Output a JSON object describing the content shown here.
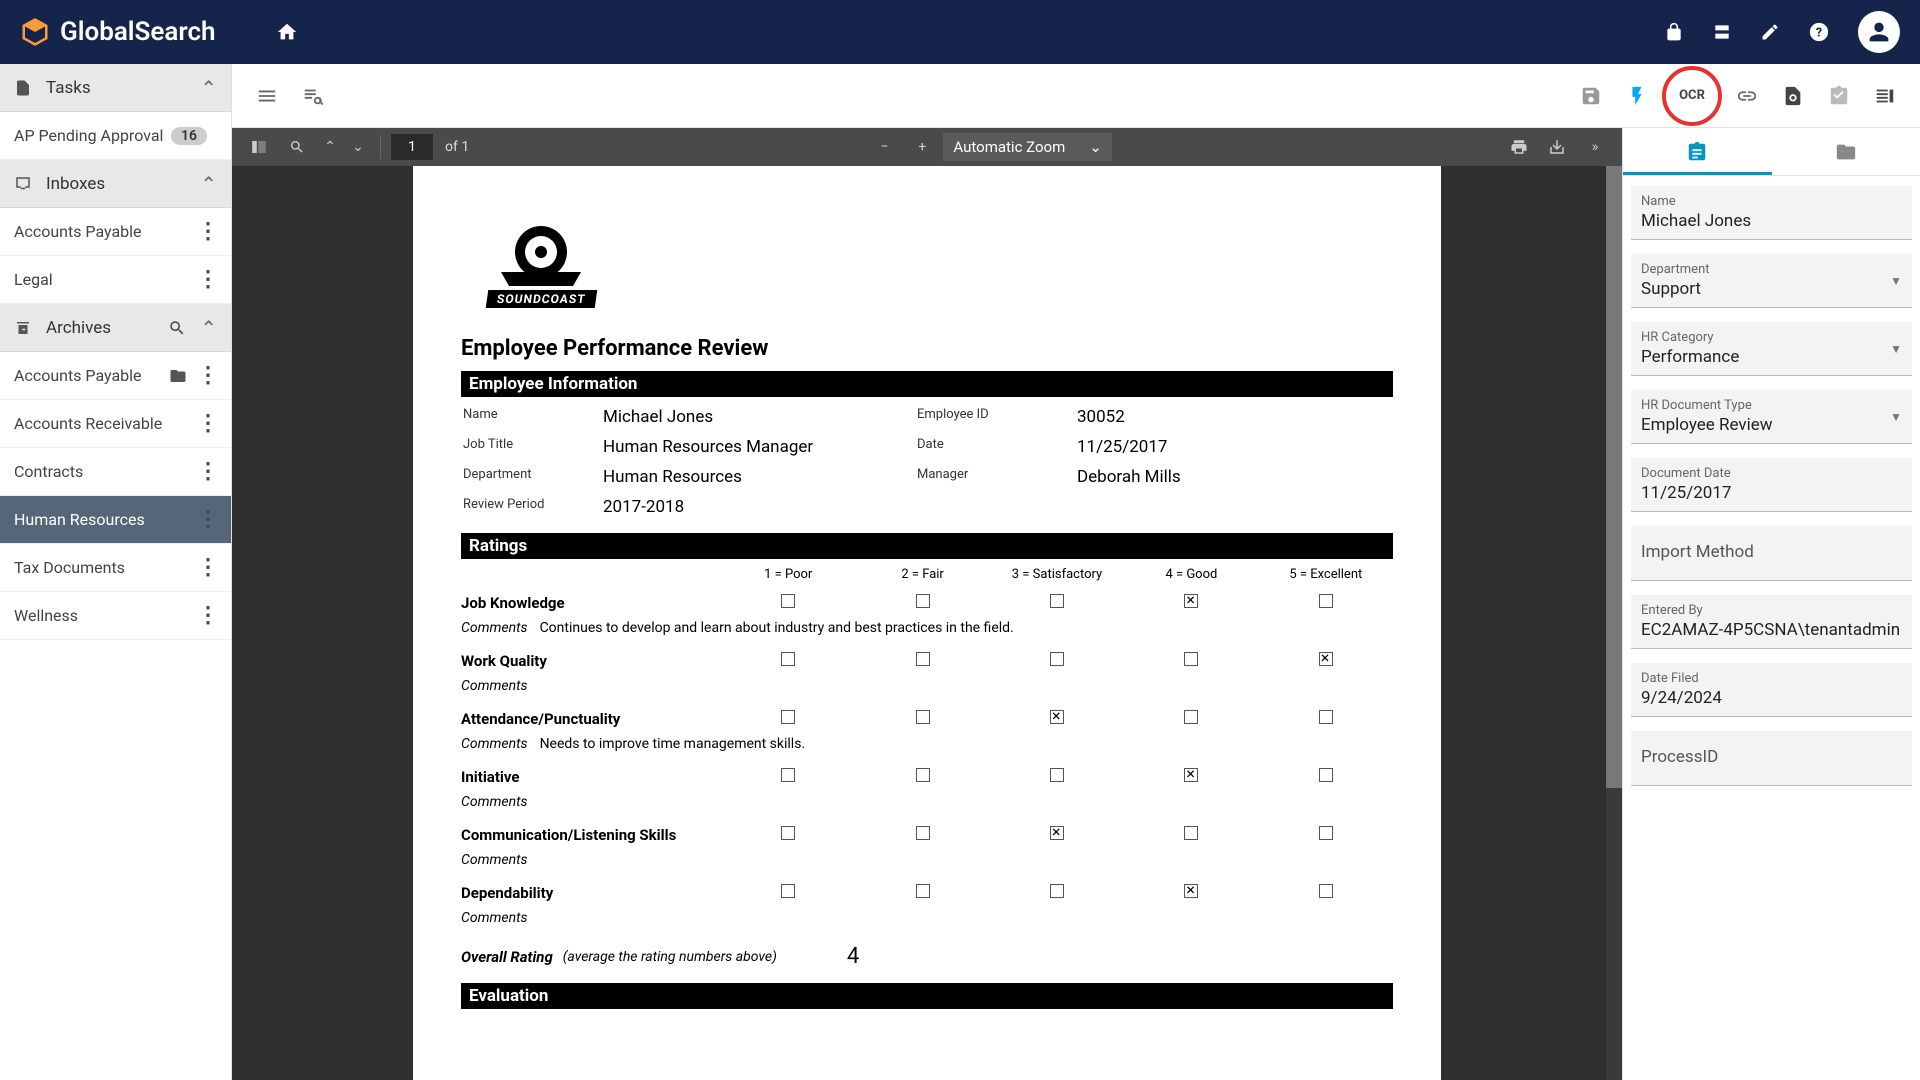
{
  "header": {
    "app_name": "GlobalSearch"
  },
  "sidebar": {
    "tasks": {
      "label": "Tasks"
    },
    "tasks_items": [
      {
        "label": "AP Pending Approval",
        "badge": "16"
      }
    ],
    "inboxes": {
      "label": "Inboxes"
    },
    "inboxes_items": [
      {
        "label": "Accounts Payable"
      },
      {
        "label": "Legal"
      }
    ],
    "archives": {
      "label": "Archives"
    },
    "archives_items": [
      {
        "label": "Accounts Payable",
        "folder": true
      },
      {
        "label": "Accounts Receivable"
      },
      {
        "label": "Contracts"
      },
      {
        "label": "Human Resources",
        "selected": true
      },
      {
        "label": "Tax Documents"
      },
      {
        "label": "Wellness"
      }
    ]
  },
  "toolbar": {
    "ocr_label": "OCR"
  },
  "pdf": {
    "current_page": "1",
    "page_of": "of 1",
    "zoom": "Automatic Zoom"
  },
  "document": {
    "logo_text": "SOUNDCOAST",
    "title": "Employee Performance Review",
    "section_info": "Employee Information",
    "section_ratings": "Ratings",
    "section_evaluation": "Evaluation",
    "info": {
      "name_label": "Name",
      "name": "Michael Jones",
      "empid_label": "Employee ID",
      "empid": "30052",
      "jobtitle_label": "Job Title",
      "jobtitle": "Human Resources Manager",
      "date_label": "Date",
      "date": "11/25/2017",
      "dept_label": "Department",
      "dept": "Human Resources",
      "manager_label": "Manager",
      "manager": "Deborah Mills",
      "period_label": "Review Period",
      "period": "2017-2018"
    },
    "rating_legend": {
      "c1": "1 = Poor",
      "c2": "2 = Fair",
      "c3": "3 = Satisfactory",
      "c4": "4 = Good",
      "c5": "5 = Excellent"
    },
    "ratings": [
      {
        "label": "Job Knowledge",
        "checked": 4,
        "comment": "Continues to develop and learn about industry and best practices in the field."
      },
      {
        "label": "Work Quality",
        "checked": 5,
        "comment": ""
      },
      {
        "label": "Attendance/Punctuality",
        "checked": 3,
        "comment": "Needs to improve time management skills."
      },
      {
        "label": "Initiative",
        "checked": 4,
        "comment": ""
      },
      {
        "label": "Communication/Listening Skills",
        "checked": 3,
        "comment": ""
      },
      {
        "label": "Dependability",
        "checked": 4,
        "comment": ""
      }
    ],
    "comments_label": "Comments",
    "overall": {
      "label": "Overall Rating",
      "sub": "(average the rating numbers above)",
      "value": "4"
    }
  },
  "panel": {
    "fields": [
      {
        "label": "Name",
        "value": "Michael Jones",
        "dropdown": false
      },
      {
        "label": "Department",
        "value": "Support",
        "dropdown": true
      },
      {
        "label": "HR Category",
        "value": "Performance",
        "dropdown": true
      },
      {
        "label": "HR Document Type",
        "value": "Employee Review",
        "dropdown": true
      },
      {
        "label": "Document Date",
        "value": "11/25/2017",
        "dropdown": false
      },
      {
        "label": "Import Method",
        "value": "",
        "dropdown": false
      },
      {
        "label": "Entered By",
        "value": "EC2AMAZ-4P5CSNA\\tenantadmin",
        "dropdown": false
      },
      {
        "label": "Date Filed",
        "value": "9/24/2024",
        "dropdown": false
      },
      {
        "label": "ProcessID",
        "value": "",
        "dropdown": false
      }
    ]
  }
}
